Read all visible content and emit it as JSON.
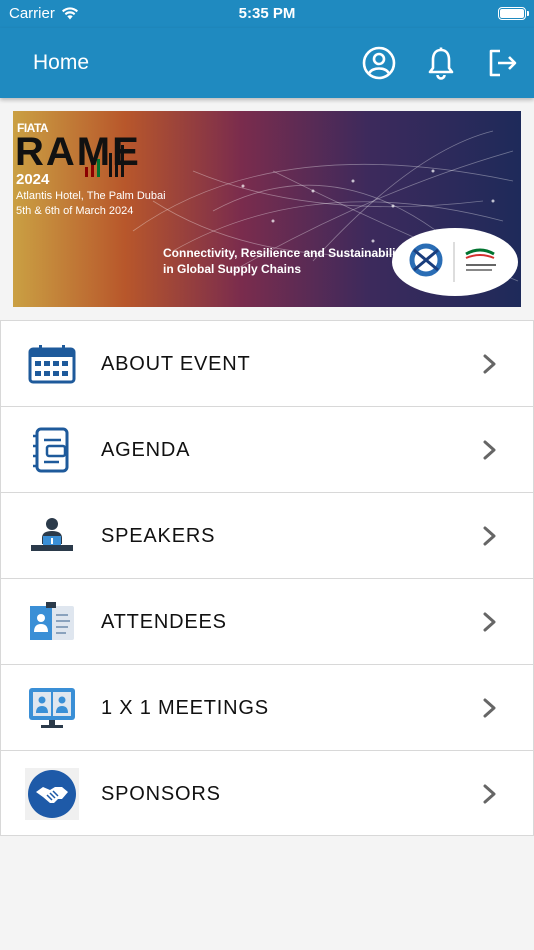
{
  "status": {
    "carrier": "Carrier",
    "time": "5:35 PM"
  },
  "header": {
    "title": "Home",
    "actions": [
      "profile-icon",
      "bell-icon",
      "logout-icon"
    ],
    "bg_color": "#1f8ac0"
  },
  "banner": {
    "org": "FIATA",
    "event": "RAME",
    "year": "2024",
    "venue": "Atlantis Hotel, The Palm Dubai",
    "dates": "5th & 6th of March 2024",
    "tagline_line1": "Connectivity, Resilience and Sustainability",
    "tagline_line2": "in Global Supply Chains"
  },
  "menu": [
    {
      "label": "ABOUT EVENT",
      "icon": "calendar-icon"
    },
    {
      "label": "AGENDA",
      "icon": "agenda-icon"
    },
    {
      "label": "SPEAKERS",
      "icon": "speaker-podium-icon"
    },
    {
      "label": "ATTENDEES",
      "icon": "id-badge-icon"
    },
    {
      "label": "1 X 1 MEETINGS",
      "icon": "video-meeting-icon"
    },
    {
      "label": "SPONSORS",
      "icon": "handshake-icon"
    }
  ]
}
